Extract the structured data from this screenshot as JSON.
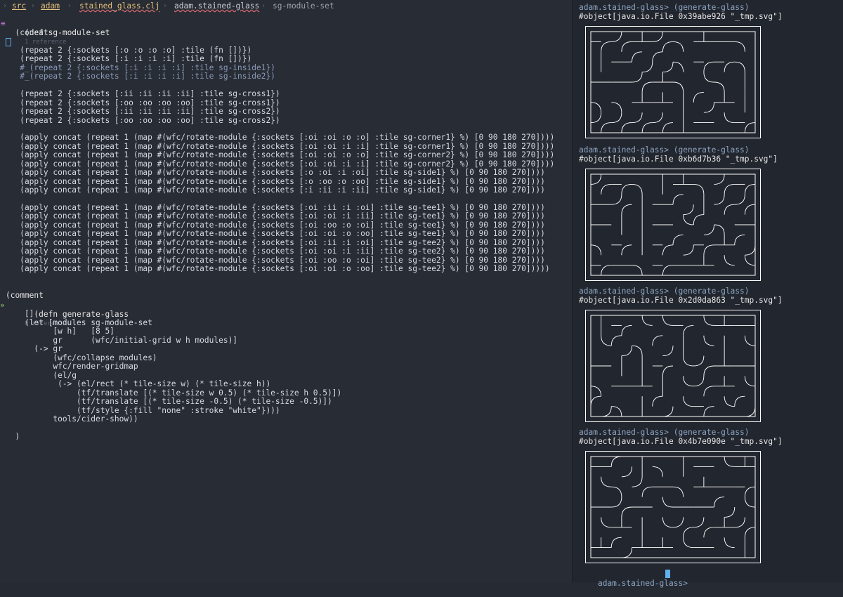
{
  "breadcrumb": {
    "items": [
      "src",
      "adam",
      "stained_glass.clj",
      "adam.stained-glass",
      "sg-module-set"
    ]
  },
  "code": {
    "def_line": "(def sg-module-set",
    "def_refs": "1 reference",
    "lines1": [
      "  (concat",
      "",
      "   (repeat 2 {:sockets [:o :o :o :o] :tile (fn [])})",
      "   (repeat 2 {:sockets [:i :i :i :i] :tile (fn [])})",
      "   #_(repeat 2 {:sockets [:i :i :i :i] :tile sg-inside1})",
      "   #_(repeat 2 {:sockets [:i :i :i :i] :tile sg-inside2})",
      "",
      "   (repeat 2 {:sockets [:ii :ii :ii :ii] :tile sg-cross1})",
      "   (repeat 2 {:sockets [:oo :oo :oo :oo] :tile sg-cross1})",
      "   (repeat 2 {:sockets [:ii :ii :ii :ii] :tile sg-cross2})",
      "   (repeat 2 {:sockets [:oo :oo :oo :oo] :tile sg-cross2})",
      "",
      "   (apply concat (repeat 1 (map #(wfc/rotate-module {:sockets [:oi :oi :o :o] :tile sg-corner1} %) [0 90 180 270])))",
      "   (apply concat (repeat 1 (map #(wfc/rotate-module {:sockets [:oi :oi :i :i] :tile sg-corner1} %) [0 90 180 270])))",
      "   (apply concat (repeat 1 (map #(wfc/rotate-module {:sockets [:oi :oi :o :o] :tile sg-corner2} %) [0 90 180 270])))",
      "   (apply concat (repeat 1 (map #(wfc/rotate-module {:sockets [:oi :oi :i :i] :tile sg-corner2} %) [0 90 180 270])))",
      "   (apply concat (repeat 1 (map #(wfc/rotate-module {:sockets [:o :oi :i :oi] :tile sg-side1} %) [0 90 180 270])))",
      "   (apply concat (repeat 1 (map #(wfc/rotate-module {:sockets [:o :oo :o :oo] :tile sg-side1} %) [0 90 180 270])))",
      "   (apply concat (repeat 1 (map #(wfc/rotate-module {:sockets [:i :ii :i :ii] :tile sg-side1} %) [0 90 180 270])))",
      "",
      "   (apply concat (repeat 1 (map #(wfc/rotate-module {:sockets [:oi :ii :i :oi] :tile sg-tee1} %) [0 90 180 270])))",
      "   (apply concat (repeat 1 (map #(wfc/rotate-module {:sockets [:oi :oi :i :ii] :tile sg-tee1} %) [0 90 180 270])))",
      "   (apply concat (repeat 1 (map #(wfc/rotate-module {:sockets [:oi :oo :o :oi] :tile sg-tee1} %) [0 90 180 270])))",
      "   (apply concat (repeat 1 (map #(wfc/rotate-module {:sockets [:oi :oi :o :oo] :tile sg-tee1} %) [0 90 180 270])))",
      "   (apply concat (repeat 1 (map #(wfc/rotate-module {:sockets [:oi :ii :i :oi] :tile sg-tee2} %) [0 90 180 270])))",
      "   (apply concat (repeat 1 (map #(wfc/rotate-module {:sockets [:oi :oi :i :ii] :tile sg-tee2} %) [0 90 180 270])))",
      "   (apply concat (repeat 1 (map #(wfc/rotate-module {:sockets [:oi :oo :o :oi] :tile sg-tee2} %) [0 90 180 270])))",
      "   (apply concat (repeat 1 (map #(wfc/rotate-module {:sockets [:oi :oi :o :oo] :tile sg-tee2} %) [0 90 180 270]))))"
    ],
    "comment_line": "(comment",
    "defn_line": "  (defn generate-glass",
    "defn_refs": "0 references",
    "lines2": [
      "    []",
      "    (let [modules sg-module-set",
      "          [w h]   [8 5]",
      "          gr      (wfc/initial-grid w h modules)]",
      "      (-> gr",
      "          (wfc/collapse modules)",
      "          wfc/render-gridmap",
      "          (el/g",
      "           (-> (el/rect (* tile-size w) (* tile-size h))",
      "               (tf/translate [(* tile-size w 0.5) (* tile-size h 0.5)])",
      "               (tf/translate [(* tile-size -0.5) (* tile-size -0.5)])",
      "               (tf/style {:fill \"none\" :stroke \"white\"})))",
      "          tools/cider-show))",
      "",
      "  )"
    ]
  },
  "repl": {
    "prompt": "adam.stained-glass>",
    "command": "(generate-glass)",
    "outputs": [
      {
        "obj": "#object[java.io.File 0x39abe926 \"_tmp.svg\"]"
      },
      {
        "obj": "#object[java.io.File 0xb6d7b36 \"_tmp.svg\"]"
      },
      {
        "obj": "#object[java.io.File 0x2d0da863 \"_tmp.svg\"]"
      },
      {
        "obj": "#object[java.io.File 0x4b7e090e \"_tmp.svg\"]"
      }
    ],
    "final_prompt": "adam.stained-glass>"
  },
  "colors": {
    "editor_bg": "#282c34",
    "repl_bg": "#22262e",
    "crumb_dir": "#e5c07b",
    "error_underline": "#e06c75",
    "cursor": "#61afef"
  }
}
